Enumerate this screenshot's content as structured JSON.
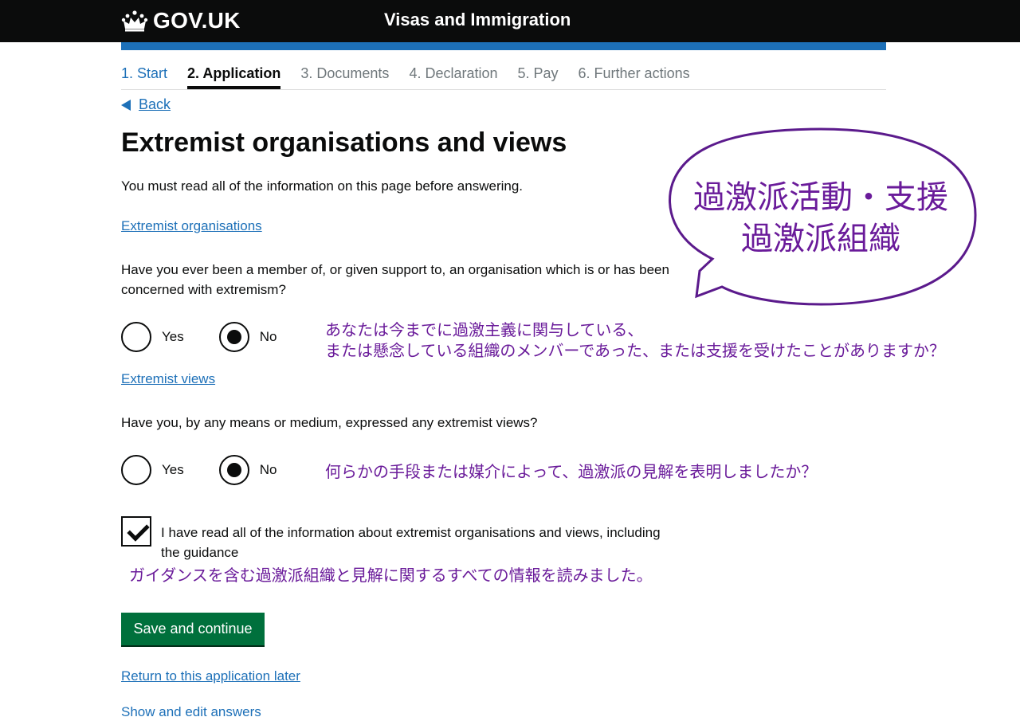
{
  "header": {
    "logo_text": "GOV.UK",
    "service_name": "Visas and Immigration"
  },
  "steps": [
    {
      "label": "1. Start",
      "state": "done"
    },
    {
      "label": "2. Application",
      "state": "active"
    },
    {
      "label": "3. Documents",
      "state": "upcoming"
    },
    {
      "label": "4. Declaration",
      "state": "upcoming"
    },
    {
      "label": "5. Pay",
      "state": "upcoming"
    },
    {
      "label": "6. Further actions",
      "state": "upcoming"
    }
  ],
  "back_label": "Back",
  "page_title": "Extremist organisations and views",
  "intro": "You must read all of the information on this page before answering.",
  "section1": {
    "link": "Extremist organisations",
    "question": "Have you ever been a member of, or given support to, an organisation which is or has been concerned with extremism?",
    "yes_label": "Yes",
    "no_label": "No",
    "selected": "No"
  },
  "section2": {
    "link": "Extremist views",
    "question": "Have you, by any means or medium, expressed any extremist views?",
    "yes_label": "Yes",
    "no_label": "No",
    "selected": "No"
  },
  "confirmation": {
    "label": "I have read all of the information about extremist organisations and views, including the guidance",
    "checked": true
  },
  "save_button": "Save and continue",
  "return_link": "Return to this application later",
  "show_edit_link": "Show and edit answers",
  "annotations": {
    "bubble_line1": "過激派活動・支援",
    "bubble_line2": "過激派組織",
    "q1_line1": "あなたは今までに過激主義に関与している、",
    "q1_line2": "または懸念している組織のメンバーであった、または支援を受けたことがありますか？",
    "q2": "何らかの手段または媒介によって、過激派の見解を表明しましたか？",
    "confirm": "ガイダンスを含む過激派組織と見解に関するすべての情報を読みました。",
    "color": "#6a1b9a"
  },
  "colors": {
    "header_bg": "#0b0c0c",
    "blue_bar": "#1d70b8",
    "link": "#1d70b8",
    "button_green": "#00703c"
  }
}
